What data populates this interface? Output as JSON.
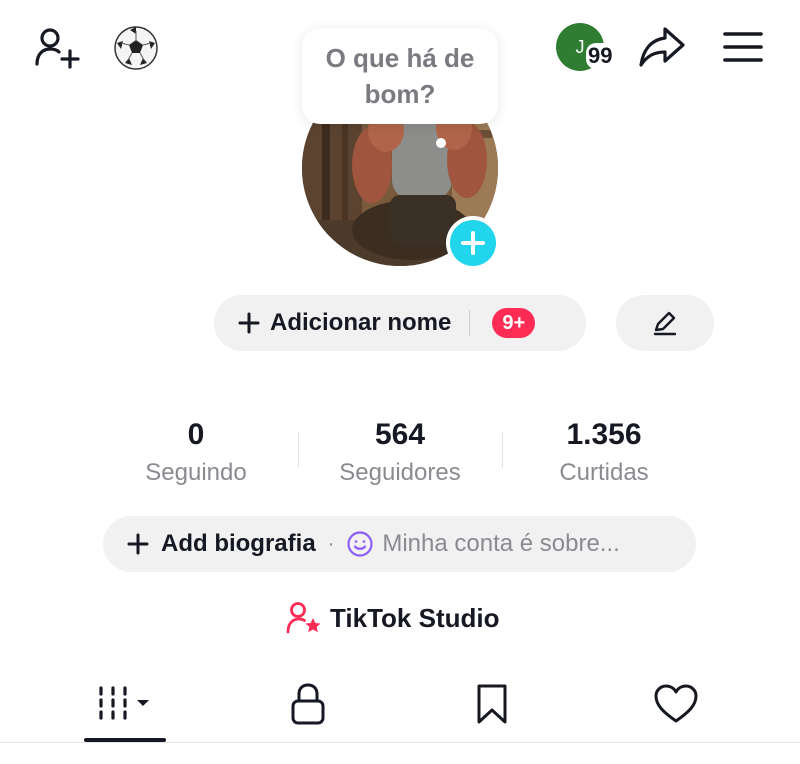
{
  "header": {
    "avatar_initial": "J",
    "notification_count": "99"
  },
  "bubble": {
    "text": "O que há de bom?"
  },
  "profile": {
    "add_name_label": "Adicionar nome",
    "add_name_badge": "9+"
  },
  "stats": {
    "following": {
      "value": "0",
      "label": "Seguindo"
    },
    "followers": {
      "value": "564",
      "label": "Seguidores"
    },
    "likes": {
      "value": "1.356",
      "label": "Curtidas"
    }
  },
  "bio": {
    "add_label": "Add biografia",
    "placeholder": "Minha conta é sobre..."
  },
  "studio": {
    "label": "TikTok Studio"
  },
  "tabs": [
    "videos-icon",
    "private-lock-icon",
    "saved-bookmark-icon",
    "liked-heart-icon"
  ],
  "colors": {
    "accent_pink": "#fe2c55",
    "accent_cyan": "#20d5ec",
    "avatar_green": "#2e7d32",
    "pill_bg": "#f1f1f2",
    "text_primary": "#161823",
    "text_secondary": "#8a8b91",
    "smile_purple": "#8b5cf6"
  }
}
